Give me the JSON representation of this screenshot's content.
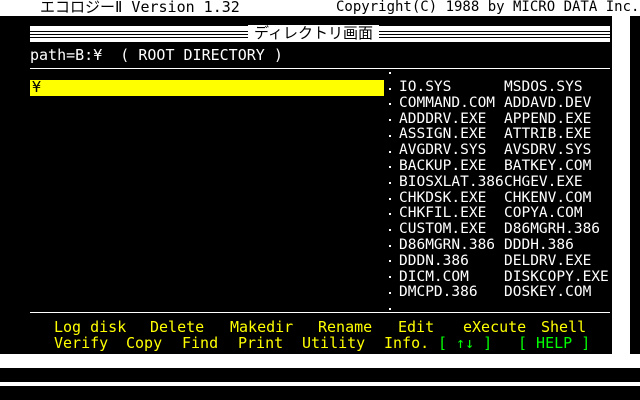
{
  "header": {
    "app_title": "エコロジーⅡ Version 1.32",
    "copyright": "Copyright(C) 1988 by MICRO DATA Inc."
  },
  "window": {
    "title": "ディレクトリ画面"
  },
  "path": {
    "text": "path=B:¥  ( ROOT DIRECTORY )"
  },
  "tree": {
    "selected": "¥"
  },
  "files": [
    "IO.SYS",
    "MSDOS.SYS",
    "COMMAND.COM",
    "ADDAVD.DEV",
    "ADDDRV.EXE",
    "APPEND.EXE",
    "ASSIGN.EXE",
    "ATTRIB.EXE",
    "AVGDRV.SYS",
    "AVSDRV.SYS",
    "BACKUP.EXE",
    "BATKEY.COM",
    "BIOSXLAT.386",
    "CHGEV.EXE",
    "CHKDSK.EXE",
    "CHKENV.COM",
    "CHKFIL.EXE",
    "COPYA.COM",
    "CUSTOM.EXE",
    "D86MGRH.386",
    "D86MGRN.386",
    "DDDH.386",
    "DDDN.386",
    "DELDRV.EXE",
    "DICM.COM",
    "DISKCOPY.EXE",
    "DMCPD.386",
    "DOSKEY.COM"
  ],
  "commands": {
    "row1": [
      "Log disk",
      "Delete",
      "Makedir",
      "Rename",
      "Edit",
      "eXecute",
      "Shell"
    ],
    "row2": [
      "Verify",
      "Copy",
      "Find",
      "Print",
      "Utility",
      "Info."
    ],
    "arrows": "[ ↑↓ ]",
    "help": "[ HELP ]"
  },
  "colors": {
    "background": "#000000",
    "text": "#ffffff",
    "selection": "#ffff00",
    "commands": "#ffff00",
    "help": "#00ff00"
  }
}
